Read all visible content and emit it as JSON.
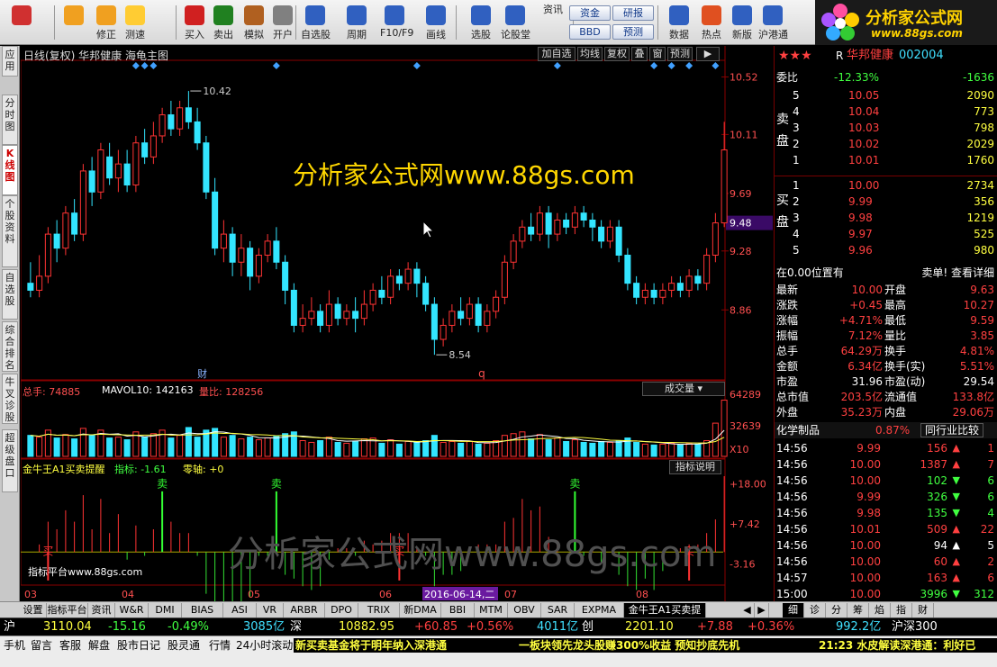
{
  "toolbar": {
    "buttons": [
      {
        "label": "",
        "icon": "home-grid-icon",
        "color": "#d03030"
      },
      {
        "label": "",
        "icon": "back-arrow-icon",
        "color": "#f0a020"
      },
      {
        "label": "修正",
        "icon": "refresh-icon",
        "color": "#f0a020"
      },
      {
        "label": "测速",
        "icon": "clock-icon",
        "color": "#ffcc33"
      },
      {
        "label": "买入",
        "icon": "buy-icon",
        "color": "#d02020"
      },
      {
        "label": "卖出",
        "icon": "sell-icon",
        "color": "#208020"
      },
      {
        "label": "模拟",
        "icon": "hammer-icon",
        "color": "#b06020"
      },
      {
        "label": "开户",
        "icon": "lock-icon",
        "color": "#808080"
      },
      {
        "label": "自选股",
        "icon": "star-icon",
        "color": "#3060c0"
      },
      {
        "label": "周期",
        "icon": "period-icon",
        "color": "#3060c0"
      },
      {
        "label": "F10/F9",
        "icon": "f10-icon",
        "color": "#3060c0"
      },
      {
        "label": "画线",
        "icon": "pen-icon",
        "color": "#3060c0"
      },
      {
        "label": "选股",
        "icon": "pick-stock-icon",
        "color": "#3060c0"
      },
      {
        "label": "论股堂",
        "icon": "forum-icon",
        "color": "#3060c0"
      },
      {
        "label": "资讯",
        "icon": "",
        "color": ""
      },
      {
        "label": "数据",
        "icon": "pe-icon",
        "color": "#3060c0"
      },
      {
        "label": "热点",
        "icon": "fire-icon",
        "color": "#e05020"
      },
      {
        "label": "新版",
        "icon": "new-version-icon",
        "color": "#3060c0"
      },
      {
        "label": "沪港通",
        "icon": "hk-connect-icon",
        "color": "#3060c0"
      }
    ],
    "pills": [
      "资金",
      "研报",
      "BBD",
      "预测"
    ]
  },
  "logo": {
    "title": "分析家公式网",
    "url": "www.88gs.com"
  },
  "left_tabs": [
    {
      "label": "应用",
      "active": false
    },
    {
      "label": "分时图",
      "active": false
    },
    {
      "label": "K线图",
      "active": true
    },
    {
      "label": "个股资料",
      "active": false
    },
    {
      "label": "自选股",
      "active": false
    },
    {
      "label": "综合排名",
      "active": false
    },
    {
      "label": "牛叉诊股",
      "active": false
    },
    {
      "label": "超级盘口",
      "active": false
    }
  ],
  "main": {
    "title": "日线(复权)  华邦健康 海龟主图",
    "buttons": [
      "加自选",
      "均线",
      "复权",
      "叠",
      "窗",
      "预测"
    ],
    "watermark_top": "分析家公式网www.88gs.com",
    "watermark_bottom": "分析家公式网www.88gs.com",
    "price_axis": [
      "10.52",
      "10.11",
      "9.69",
      "9.48",
      "9.28",
      "8.86"
    ],
    "current_price_label": "9.48",
    "high_annotation": "10.42",
    "low_annotation": "8.54",
    "cai_marker": "财",
    "q_marker": "q",
    "volume_panel": {
      "total": "总手: 74885",
      "mavol": "MAVOL10: 142163",
      "ratio": "量比: 128256",
      "dropdown": "成交量",
      "axis": [
        "64289",
        "32639",
        "X10"
      ]
    },
    "indicator_panel": {
      "name": "金牛王A1买卖提醒",
      "value": "指标: -1.61",
      "zero": "零轴: +0",
      "help": "指标说明",
      "axis": [
        "+18.00",
        "+7.42",
        "-3.16"
      ],
      "sell_label": "卖",
      "buy_label": "买",
      "footer": "指标平台www.88gs.com"
    },
    "date_axis": [
      "03",
      "04",
      "05",
      "06",
      "2016-06-14,二",
      "07",
      "08"
    ]
  },
  "chart_data": {
    "type": "candlestick",
    "title": "日线(复权)  华邦健康 海龟主图",
    "ylim": [
      8.4,
      10.6
    ],
    "candles": [
      [
        9.05,
        9.0,
        9.2,
        8.95
      ],
      [
        9.0,
        9.1,
        9.25,
        8.95
      ],
      [
        9.1,
        9.4,
        9.45,
        9.05
      ],
      [
        9.4,
        9.3,
        9.5,
        9.2
      ],
      [
        9.3,
        9.55,
        9.6,
        9.25
      ],
      [
        9.55,
        9.4,
        9.65,
        9.35
      ],
      [
        9.4,
        9.85,
        9.9,
        9.35
      ],
      [
        9.85,
        9.7,
        9.95,
        9.6
      ],
      [
        9.7,
        10.0,
        10.05,
        9.65
      ],
      [
        9.95,
        9.8,
        10.05,
        9.75
      ],
      [
        9.8,
        9.9,
        10.0,
        9.7
      ],
      [
        9.9,
        9.75,
        10.0,
        9.7
      ],
      [
        9.75,
        10.05,
        10.1,
        9.7
      ],
      [
        10.05,
        9.95,
        10.15,
        9.9
      ],
      [
        9.95,
        10.1,
        10.2,
        9.9
      ],
      [
        10.1,
        10.25,
        10.3,
        10.05
      ],
      [
        10.25,
        10.15,
        10.35,
        10.1
      ],
      [
        10.15,
        10.3,
        10.35,
        10.1
      ],
      [
        10.3,
        10.2,
        10.42,
        10.15
      ],
      [
        10.2,
        10.05,
        10.3,
        10.0
      ],
      [
        10.05,
        9.7,
        10.1,
        9.65
      ],
      [
        9.7,
        9.3,
        9.8,
        9.25
      ],
      [
        9.3,
        9.4,
        9.5,
        9.2
      ],
      [
        9.4,
        9.2,
        9.45,
        9.1
      ],
      [
        9.2,
        9.3,
        9.4,
        9.1
      ],
      [
        9.3,
        9.1,
        9.35,
        9.0
      ],
      [
        9.1,
        9.25,
        9.3,
        9.05
      ],
      [
        9.25,
        9.35,
        9.4,
        9.2
      ],
      [
        9.35,
        9.2,
        9.45,
        9.15
      ],
      [
        9.2,
        9.0,
        9.25,
        8.9
      ],
      [
        9.0,
        8.75,
        9.05,
        8.7
      ],
      [
        8.75,
        8.8,
        8.9,
        8.7
      ],
      [
        8.8,
        8.85,
        8.95,
        8.75
      ],
      [
        8.85,
        8.75,
        8.9,
        8.7
      ],
      [
        8.75,
        8.9,
        9.0,
        8.7
      ],
      [
        8.9,
        8.8,
        8.95,
        8.75
      ],
      [
        8.8,
        8.85,
        8.9,
        8.75
      ],
      [
        8.85,
        8.8,
        8.95,
        8.7
      ],
      [
        8.8,
        8.9,
        9.0,
        8.75
      ],
      [
        8.9,
        9.0,
        9.05,
        8.85
      ],
      [
        9.0,
        8.95,
        9.1,
        8.9
      ],
      [
        8.95,
        9.1,
        9.15,
        8.9
      ],
      [
        9.1,
        9.05,
        9.15,
        9.0
      ],
      [
        9.05,
        9.15,
        9.2,
        9.0
      ],
      [
        9.15,
        9.05,
        9.2,
        8.95
      ],
      [
        9.05,
        8.9,
        9.1,
        8.85
      ],
      [
        8.9,
        8.65,
        8.95,
        8.54
      ],
      [
        8.65,
        8.75,
        8.8,
        8.6
      ],
      [
        8.75,
        8.85,
        8.9,
        8.7
      ],
      [
        8.85,
        8.8,
        8.95,
        8.75
      ],
      [
        8.8,
        8.9,
        8.95,
        8.75
      ],
      [
        8.9,
        8.75,
        8.95,
        8.7
      ],
      [
        8.75,
        8.85,
        8.9,
        8.7
      ],
      [
        8.85,
        8.95,
        9.0,
        8.8
      ],
      [
        8.95,
        9.2,
        9.25,
        8.9
      ],
      [
        9.2,
        9.35,
        9.4,
        9.15
      ],
      [
        9.35,
        9.45,
        9.5,
        9.3
      ],
      [
        9.45,
        9.4,
        9.55,
        9.35
      ],
      [
        9.4,
        9.55,
        9.6,
        9.35
      ],
      [
        9.55,
        9.4,
        9.6,
        9.3
      ],
      [
        9.4,
        9.5,
        9.55,
        9.35
      ],
      [
        9.5,
        9.45,
        9.55,
        9.4
      ],
      [
        9.45,
        9.55,
        9.6,
        9.4
      ],
      [
        9.55,
        9.5,
        9.6,
        9.45
      ],
      [
        9.5,
        9.45,
        9.55,
        9.35
      ],
      [
        9.45,
        9.35,
        9.5,
        9.3
      ],
      [
        9.35,
        9.45,
        9.5,
        9.3
      ],
      [
        9.45,
        9.25,
        9.5,
        9.2
      ],
      [
        9.25,
        9.05,
        9.3,
        9.0
      ],
      [
        9.05,
        8.95,
        9.1,
        8.9
      ],
      [
        8.95,
        9.0,
        9.05,
        8.9
      ],
      [
        9.0,
        8.95,
        9.05,
        8.9
      ],
      [
        8.95,
        9.0,
        9.05,
        8.9
      ],
      [
        9.0,
        9.05,
        9.1,
        8.95
      ],
      [
        9.05,
        9.0,
        9.1,
        8.95
      ],
      [
        9.0,
        9.1,
        9.15,
        8.95
      ],
      [
        9.1,
        9.05,
        9.15,
        9.0
      ],
      [
        9.05,
        9.25,
        9.3,
        9.0
      ],
      [
        9.25,
        9.48,
        9.55,
        9.2
      ],
      [
        9.48,
        10.0,
        10.2,
        9.45
      ]
    ],
    "volume_ylim": [
      0,
      70000
    ],
    "volume": [
      24000,
      22000,
      30000,
      21000,
      25000,
      20000,
      32000,
      24000,
      30000,
      21000,
      22000,
      19000,
      28000,
      22000,
      26000,
      30000,
      21000,
      24000,
      33000,
      22000,
      30000,
      32000,
      22000,
      24000,
      20000,
      22000,
      19000,
      21000,
      23000,
      26000,
      28000,
      18000,
      16000,
      18000,
      22000,
      16000,
      15000,
      17000,
      20000,
      21000,
      15000,
      19000,
      14000,
      17000,
      16000,
      18000,
      24000,
      16000,
      17000,
      15000,
      17000,
      14000,
      15000,
      18000,
      24000,
      26000,
      28000,
      20000,
      25000,
      19000,
      21000,
      17000,
      19000,
      16000,
      15000,
      17000,
      16000,
      18000,
      21000,
      16000,
      14000,
      13000,
      14000,
      15000,
      13000,
      15000,
      14000,
      18000,
      38000,
      64289
    ],
    "indicator_ylim": [
      -8,
      20
    ],
    "indicator_zero": 0,
    "indicator_signals": [
      {
        "index": 2,
        "type": "buy"
      },
      {
        "index": 15,
        "type": "sell"
      },
      {
        "index": 28,
        "type": "sell"
      },
      {
        "index": 42,
        "type": "buy"
      },
      {
        "index": 62,
        "type": "sell"
      },
      {
        "index": 75,
        "type": "buy"
      }
    ]
  },
  "right": {
    "stars": "★★★",
    "name_prefix": "R",
    "name": "华邦健康",
    "code": "002004",
    "weibi_label": "委比",
    "weibi": "-12.33%",
    "weicha": "-1636",
    "sell_side_label": "卖盘",
    "buy_side_label": "买盘",
    "sell": [
      {
        "n": "5",
        "price": "10.05",
        "vol": "2090"
      },
      {
        "n": "4",
        "price": "10.04",
        "vol": "773"
      },
      {
        "n": "3",
        "price": "10.03",
        "vol": "798"
      },
      {
        "n": "2",
        "price": "10.02",
        "vol": "2029"
      },
      {
        "n": "1",
        "price": "10.01",
        "vol": "1760"
      }
    ],
    "buy": [
      {
        "n": "1",
        "price": "10.00",
        "vol": "2734"
      },
      {
        "n": "2",
        "price": "9.99",
        "vol": "356"
      },
      {
        "n": "3",
        "price": "9.98",
        "vol": "1219"
      },
      {
        "n": "4",
        "price": "9.97",
        "vol": "525"
      },
      {
        "n": "5",
        "price": "9.96",
        "vol": "980"
      }
    ],
    "pos_label": "在0.00位置有",
    "pos_right": "卖单! 查看详细",
    "quote": [
      [
        "最新",
        "10.00",
        "开盘",
        "9.63"
      ],
      [
        "涨跌",
        "+0.45",
        "最高",
        "10.27"
      ],
      [
        "涨幅",
        "+4.71%",
        "最低",
        "9.59"
      ],
      [
        "振幅",
        "7.12%",
        "量比",
        "3.85"
      ],
      [
        "总手",
        "64.29万",
        "换手",
        "4.81%"
      ],
      [
        "金额",
        "6.34亿",
        "换手(实)",
        "5.51%"
      ],
      [
        "市盈",
        "31.96",
        "市盈(动)",
        "29.54"
      ],
      [
        "总市值",
        "203.5亿",
        "流通值",
        "133.8亿"
      ],
      [
        "外盘",
        "35.23万",
        "内盘",
        "29.06万"
      ]
    ],
    "industry": "化学制品",
    "industry_pct": "0.87%",
    "industry_btn": "同行业比较",
    "ticks": [
      {
        "t": "14:56",
        "p": "9.99",
        "v": "156",
        "dir": "up",
        "n": "1"
      },
      {
        "t": "14:56",
        "p": "10.00",
        "v": "1387",
        "dir": "up",
        "n": "7"
      },
      {
        "t": "14:56",
        "p": "10.00",
        "v": "102",
        "dir": "down",
        "n": "6"
      },
      {
        "t": "14:56",
        "p": "9.99",
        "v": "326",
        "dir": "down",
        "n": "6"
      },
      {
        "t": "14:56",
        "p": "9.98",
        "v": "135",
        "dir": "down",
        "n": "4"
      },
      {
        "t": "14:56",
        "p": "10.01",
        "v": "509",
        "dir": "up",
        "n": "22"
      },
      {
        "t": "14:56",
        "p": "10.00",
        "v": "94",
        "dir": "none",
        "n": "5"
      },
      {
        "t": "14:56",
        "p": "10.00",
        "v": "60",
        "dir": "up",
        "n": "2"
      },
      {
        "t": "14:57",
        "p": "10.00",
        "v": "163",
        "dir": "up",
        "n": "6"
      },
      {
        "t": "15:00",
        "p": "10.00",
        "v": "3996",
        "dir": "down",
        "n": "312"
      }
    ],
    "tabs": [
      "细",
      "诊",
      "分",
      "筹",
      "焰",
      "指",
      "财"
    ]
  },
  "bottom_tabs": [
    "设置",
    "指标平台",
    "资讯",
    "W&R",
    "DMI",
    "BIAS",
    "ASI",
    "VR",
    "ARBR",
    "DPO",
    "TRIX",
    "新DMA",
    "BBI",
    "MTM",
    "OBV",
    "SAR",
    "EXPMA",
    "金牛王A1买卖提醒"
  ],
  "index_bar": {
    "sh_label": "沪",
    "sh": "3110.04",
    "sh_chg": "-15.16",
    "sh_pct": "-0.49%",
    "sh_amt": "3085亿",
    "sz_label": "深",
    "sz": "10882.95",
    "sz_chg": "+60.85",
    "sz_pct": "+0.56%",
    "sz_amt": "4011亿",
    "cy_label": "创",
    "cy": "2201.10",
    "cy_chg": "+7.88",
    "cy_pct": "+0.36%",
    "hgt_amt": "992.2亿",
    "hgt": "沪深300"
  },
  "status_bar": {
    "items": [
      "手机",
      "留言",
      "客服",
      "解盘",
      "股市日记",
      "股灵通",
      "行情",
      "24小时滚动"
    ],
    "news1": "新买卖基金将于明年纳入深港通",
    "news2": "一板块领先龙头股赚300%收益 预知抄底先机",
    "news3": "21:23 水皮解读深港通：利好已"
  }
}
